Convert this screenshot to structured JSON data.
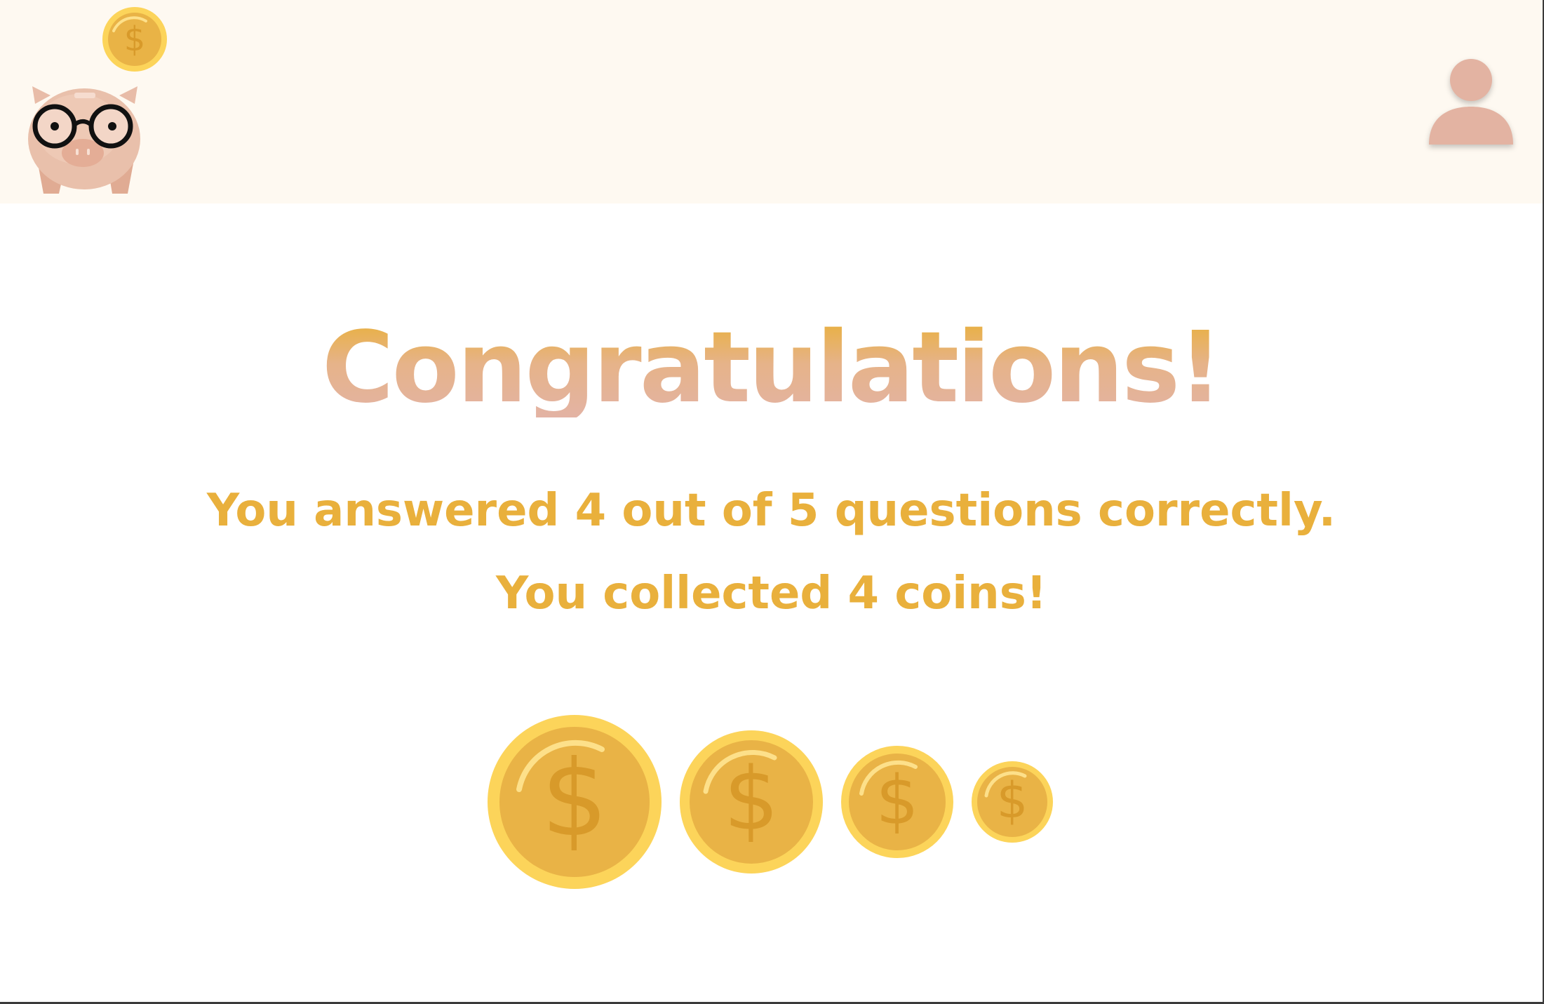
{
  "header": {
    "logo_icon": "piggy-bank-with-glasses-icon",
    "logo_coin_icon": "dollar-coin-icon",
    "profile_icon": "user-profile-icon",
    "colors": {
      "background": "#fef9f1",
      "profile": "#e3b3a2",
      "pig": "#e8bca8"
    }
  },
  "result": {
    "title": "Congratulations!",
    "score_line": "You answered 4 out of 5 questions correctly.",
    "coins_line": "You collected 4 coins!",
    "coins_collected": 4,
    "coin_symbol": "$",
    "colors": {
      "accent": "#e9b03c",
      "title_gradient_bottom": "#e3b3a4",
      "coin_outer": "#fcd45a",
      "coin_inner": "#e9b346",
      "coin_symbol": "#d89a2a"
    }
  }
}
